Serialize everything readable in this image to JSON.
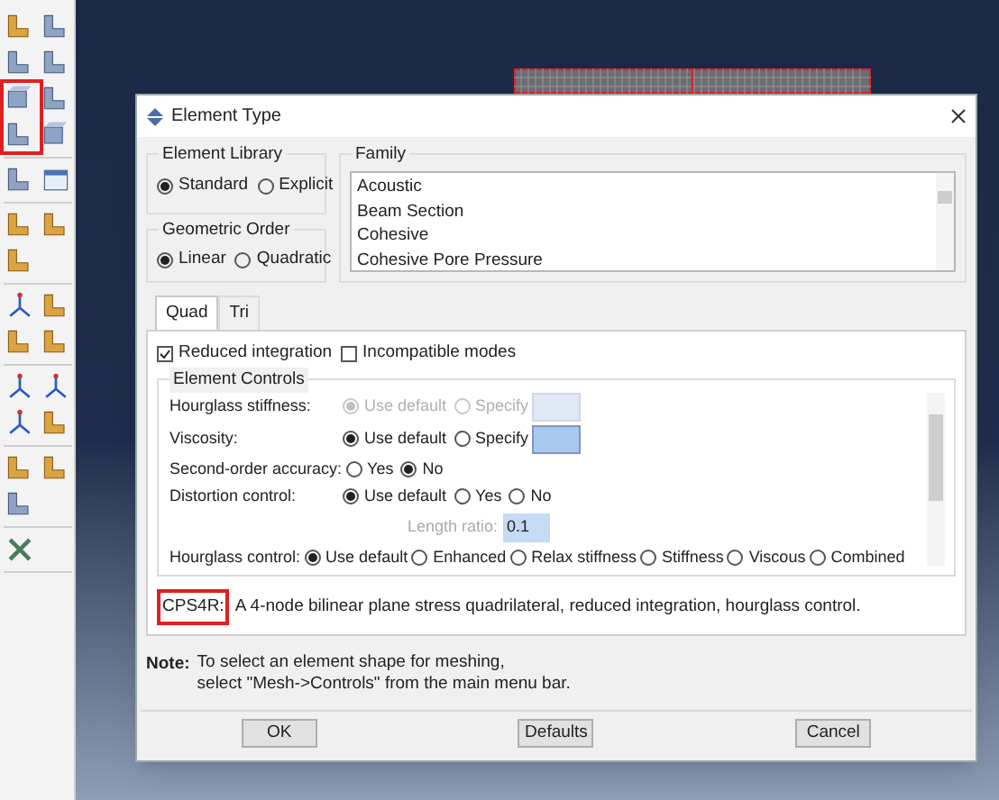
{
  "dialog": {
    "title": "Element Type",
    "element_library": {
      "label": "Element Library",
      "options": [
        {
          "label": "Standard",
          "selected": true
        },
        {
          "label": "Explicit",
          "selected": false
        }
      ]
    },
    "geometric_order": {
      "label": "Geometric Order",
      "options": [
        {
          "label": "Linear",
          "selected": true
        },
        {
          "label": "Quadratic",
          "selected": false
        }
      ]
    },
    "family": {
      "label": "Family",
      "items": [
        "Acoustic",
        "Beam Section",
        "Cohesive",
        "Cohesive Pore Pressure"
      ]
    },
    "tabs": [
      {
        "label": "Quad",
        "selected": true
      },
      {
        "label": "Tri",
        "selected": false
      }
    ],
    "options": [
      {
        "label": "Reduced integration",
        "checked": true
      },
      {
        "label": "Incompatible modes",
        "checked": false
      }
    ],
    "element_controls": {
      "label": "Element Controls",
      "rows": [
        {
          "kind": "choices_field",
          "label": "Hourglass stiffness:",
          "disabled": true,
          "choices": [
            {
              "label": "Use default",
              "selected": true
            },
            {
              "label": "Specify",
              "selected": false
            }
          ]
        },
        {
          "kind": "choices_field",
          "label": "Viscosity:",
          "disabled": false,
          "choices": [
            {
              "label": "Use default",
              "selected": true
            },
            {
              "label": "Specify",
              "selected": false
            }
          ]
        },
        {
          "kind": "choices",
          "label": "Second-order accuracy:",
          "choices": [
            {
              "label": "Yes",
              "selected": false
            },
            {
              "label": "No",
              "selected": true
            }
          ]
        },
        {
          "kind": "choices",
          "label": "Distortion control:",
          "choices": [
            {
              "label": "Use default",
              "selected": true
            },
            {
              "label": "Yes",
              "selected": false
            },
            {
              "label": "No",
              "selected": false
            }
          ]
        },
        {
          "kind": "field",
          "label": "Length ratio:",
          "disabled": true,
          "value": "0.1"
        },
        {
          "kind": "choices",
          "label": "Hourglass control:",
          "choices": [
            {
              "label": "Use default",
              "selected": true
            },
            {
              "label": "Enhanced",
              "selected": false
            },
            {
              "label": "Relax stiffness",
              "selected": false
            },
            {
              "label": "Stiffness",
              "selected": false
            },
            {
              "label": "Viscous",
              "selected": false
            },
            {
              "label": "Combined",
              "selected": false
            }
          ]
        }
      ]
    },
    "description": {
      "code": "CPS4R:",
      "text": "A 4-node bilinear plane stress quadrilateral, reduced integration, hourglass control."
    },
    "note": {
      "label": "Note:",
      "lines": [
        "To select an element shape for meshing,",
        "select \"Mesh->Controls\" from the main menu bar."
      ]
    },
    "buttons": [
      "OK",
      "Defaults",
      "Cancel"
    ]
  }
}
